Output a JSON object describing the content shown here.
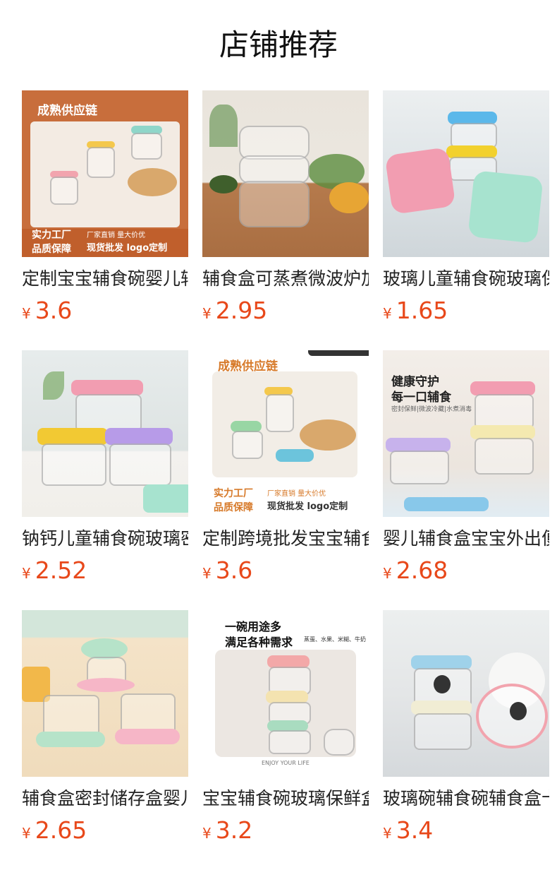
{
  "page": {
    "title": "店铺推荐"
  },
  "products": [
    {
      "name": "定制宝宝辅食碗婴儿辅食盒",
      "currency": "¥",
      "price": "3.6",
      "thumb": {
        "banner_top": "成熟供应链",
        "tag1": "实力工厂",
        "tag2": "品质保障",
        "tag3": "厂家直销 量大价优",
        "tag4": "现货批发 logo定制"
      }
    },
    {
      "name": "辅食盒可蒸煮微波炉加热",
      "currency": "¥",
      "price": "2.95",
      "thumb": {}
    },
    {
      "name": "玻璃儿童辅食碗玻璃保鲜盒",
      "currency": "¥",
      "price": "1.65",
      "thumb": {}
    },
    {
      "name": "钠钙儿童辅食碗玻璃密封",
      "currency": "¥",
      "price": "2.52",
      "thumb": {}
    },
    {
      "name": "定制跨境批发宝宝辅食碗",
      "currency": "¥",
      "price": "3.6",
      "thumb": {
        "banner_top": "成熟供应链",
        "tag1": "实力工厂",
        "tag2": "品质保障",
        "tag3": "厂家直销 量大价优",
        "tag4": "现货批发 logo定制"
      }
    },
    {
      "name": "婴儿辅食盒宝宝外出便携",
      "currency": "¥",
      "price": "2.68",
      "thumb": {
        "line1": "健康守护",
        "line2": "每一口辅食",
        "line3": "密封保鲜|微波冷藏|水煮消毒"
      }
    },
    {
      "name": "辅食盒密封储存盒婴儿",
      "currency": "¥",
      "price": "2.65",
      "thumb": {}
    },
    {
      "name": "宝宝辅食碗玻璃保鲜盒",
      "currency": "¥",
      "price": "3.2",
      "thumb": {
        "line1": "一碗用途多",
        "line2": "满足各种需求",
        "line3": "蒸蛋、水果、米糊、牛奶",
        "footer": "ENJOY YOUR LIFE"
      }
    },
    {
      "name": "玻璃碗辅食碗辅食盒卡通",
      "currency": "¥",
      "price": "3.4",
      "thumb": {}
    }
  ],
  "colors": {
    "price": "#e8481a",
    "title": "#111111"
  }
}
